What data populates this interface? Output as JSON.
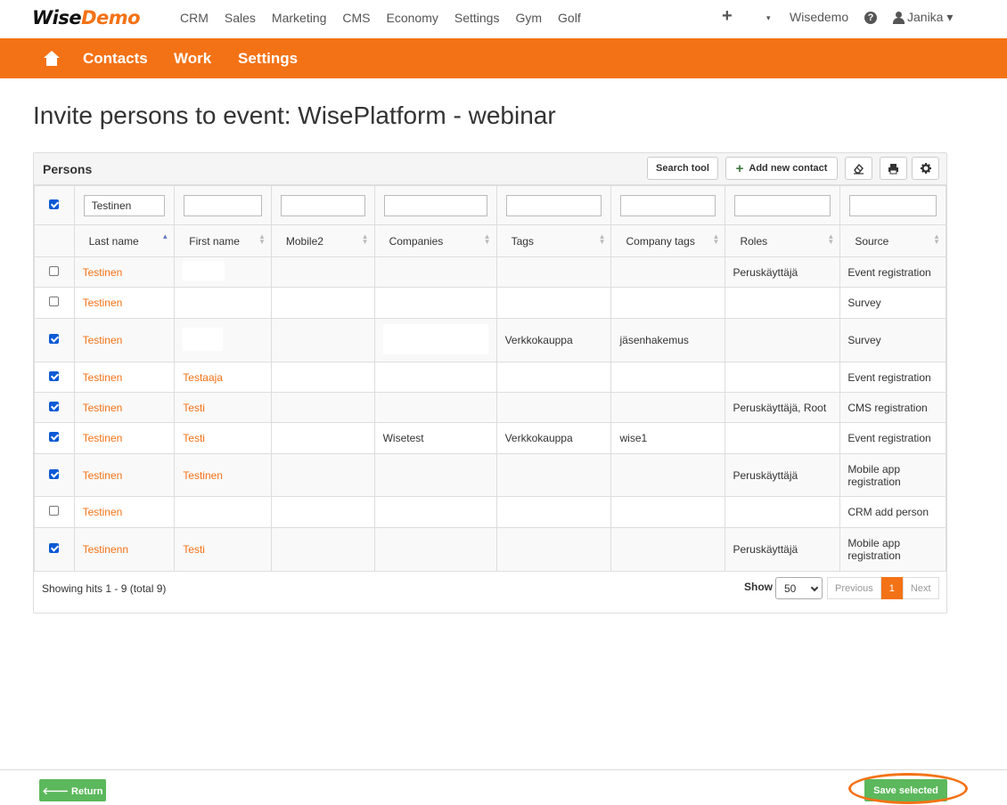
{
  "brand": {
    "part1": "Wise",
    "part2": "Demo"
  },
  "main_menu": [
    "CRM",
    "Sales",
    "Marketing",
    "CMS",
    "Economy",
    "Settings",
    "Gym",
    "Golf"
  ],
  "top_right": {
    "plus": "+",
    "caret": "▾",
    "company": "Wisedemo",
    "help": "?",
    "user": "Janika ▾"
  },
  "sub_nav": {
    "contacts": "Contacts",
    "work": "Work",
    "settings": "Settings"
  },
  "page_title": "Invite persons to event: WisePlatform - webinar",
  "panel": {
    "title": "Persons",
    "search_tool": "Search tool",
    "add_contact": "Add new contact",
    "plus": "+",
    "clear_icon": "eraser-icon",
    "print_icon": "print-icon",
    "settings_icon": "gear-icon"
  },
  "filters": {
    "last_name": "Testinen",
    "first_name": "",
    "mobile2": "",
    "companies": "",
    "tags": "",
    "company_tags": "",
    "roles": "",
    "source": ""
  },
  "columns": [
    "Last name",
    "First name",
    "Mobile2",
    "Companies",
    "Tags",
    "Company tags",
    "Roles",
    "Source"
  ],
  "rows": [
    {
      "checked": false,
      "last": "Testinen",
      "first": "",
      "mobile2": "",
      "companies": "",
      "tags": "",
      "company_tags": "",
      "roles": "Peruskäyttäjä",
      "source": "Event registration"
    },
    {
      "checked": false,
      "last": "Testinen",
      "first": "",
      "mobile2": "",
      "companies": "",
      "tags": "",
      "company_tags": "",
      "roles": "",
      "source": "Survey"
    },
    {
      "checked": true,
      "last": "Testinen",
      "first": "",
      "mobile2": "",
      "companies": "",
      "tags": "Verkkokauppa",
      "company_tags": "jäsenhakemus",
      "roles": "",
      "source": "Survey"
    },
    {
      "checked": true,
      "last": "Testinen",
      "first": "Testaaja",
      "mobile2": "",
      "companies": "",
      "tags": "",
      "company_tags": "",
      "roles": "",
      "source": "Event registration"
    },
    {
      "checked": true,
      "last": "Testinen",
      "first": "Testi",
      "mobile2": "",
      "companies": "",
      "tags": "",
      "company_tags": "",
      "roles": "Peruskäyttäjä, Root",
      "source": "CMS registration"
    },
    {
      "checked": true,
      "last": "Testinen",
      "first": "Testi",
      "mobile2": "",
      "companies": "Wisetest",
      "tags": "Verkkokauppa",
      "company_tags": "wise1",
      "roles": "",
      "source": "Event registration"
    },
    {
      "checked": true,
      "last": "Testinen",
      "first": "Testinen",
      "mobile2": "",
      "companies": "",
      "tags": "",
      "company_tags": "",
      "roles": "Peruskäyttäjä",
      "source": "Mobile app registration"
    },
    {
      "checked": false,
      "last": "Testinen",
      "first": "",
      "mobile2": "",
      "companies": "",
      "tags": "",
      "company_tags": "",
      "roles": "",
      "source": "CRM add person"
    },
    {
      "checked": true,
      "last": "Testinenn",
      "first": "Testi",
      "mobile2": "",
      "companies": "",
      "tags": "",
      "company_tags": "",
      "roles": "Peruskäyttäjä",
      "source": "Mobile app registration"
    }
  ],
  "footer": {
    "hits": "Showing hits 1 - 9 (total 9)",
    "show_label": "Show",
    "page_size": "50",
    "previous": "Previous",
    "current_page": "1",
    "next": "Next"
  },
  "actions": {
    "return": "🡐 Return",
    "save": "Save selected"
  },
  "colors": {
    "accent": "#f47216",
    "green": "#5cb85c",
    "checkbox": "#0a5ad6"
  }
}
